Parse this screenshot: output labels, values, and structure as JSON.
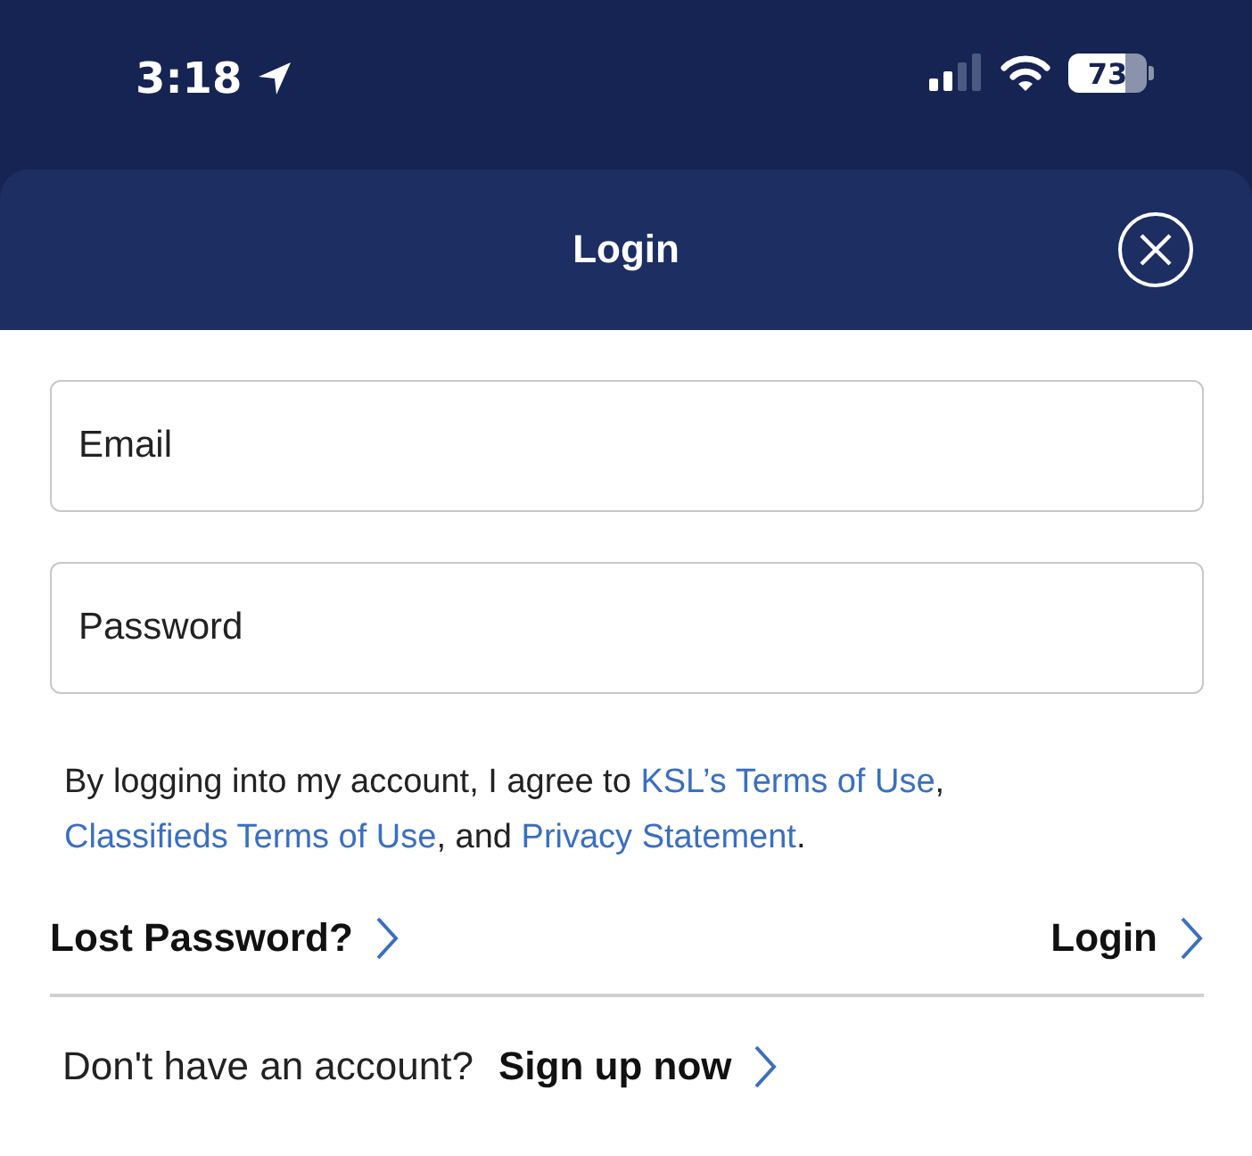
{
  "status_bar": {
    "time": "3:18",
    "battery": "73"
  },
  "header": {
    "title": "Login"
  },
  "fields": [
    {
      "placeholder": "Email"
    },
    {
      "placeholder": "Password"
    }
  ],
  "agreement": [
    {
      "kind": "text",
      "text": "By logging into my account, I agree to "
    },
    {
      "kind": "link",
      "text": "KSL’s Terms of Use"
    },
    {
      "kind": "text",
      "text": ", "
    },
    {
      "kind": "link",
      "text": "Classifieds Terms of Use"
    },
    {
      "kind": "text",
      "text": ", and "
    },
    {
      "kind": "link",
      "text": "Privacy Statement"
    },
    {
      "kind": "text",
      "text": "."
    }
  ],
  "actions": {
    "lost_password": "Lost Password?",
    "login": "Login"
  },
  "signup": {
    "prompt": "Don't have an account?",
    "link": "Sign up now"
  }
}
